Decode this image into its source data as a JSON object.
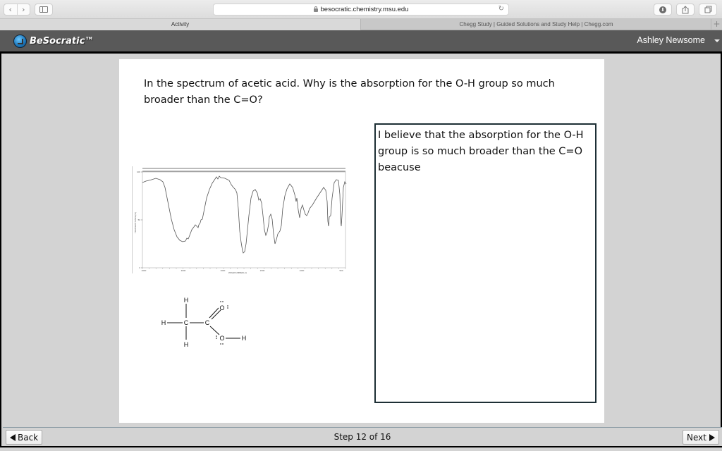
{
  "browser": {
    "url": "besocratic.chemistry.msu.edu",
    "tabs": [
      {
        "label": "Activity",
        "active": true
      },
      {
        "label": "Chegg Study | Guided Solutions and Study Help | Chegg.com",
        "active": false
      }
    ],
    "icons": {
      "back": "‹",
      "forward": "›",
      "reload": "↻",
      "download": "⬇",
      "new_tab": "+"
    }
  },
  "app": {
    "brand": "BeSocratic™",
    "user_name": "Ashley Newsome"
  },
  "question": {
    "text": "In the spectrum of acetic acid. Why is the absorption for the O-H group so much broader than the C=O?"
  },
  "spectrum_figure": {
    "type": "IR spectrum",
    "x_ticks": [
      "4000",
      "3000",
      "2000",
      "1500",
      "1000",
      "500"
    ],
    "y_ticks": [
      "100",
      "50",
      "0"
    ],
    "x_label": "WAVENUMBER(-1)",
    "y_label": "TRANSMITTANCE(%)"
  },
  "molecule": {
    "name": "acetic acid",
    "atoms": {
      "h": "H",
      "c": "C",
      "o": "O"
    }
  },
  "answer": {
    "value": "I believe that the absorption for the O-H group is so much broader than the C=O beacuse"
  },
  "footer": {
    "back_label": "Back",
    "next_label": "Next",
    "step_text": "Step 12 of 16",
    "current_step": 12,
    "total_steps": 16
  }
}
